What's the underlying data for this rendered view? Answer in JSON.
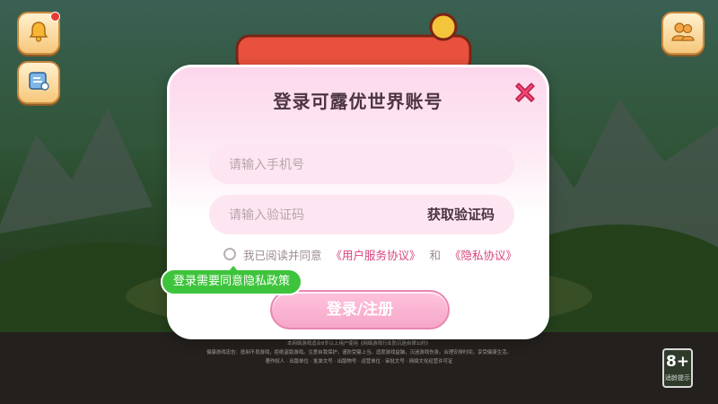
{
  "dialog": {
    "title": "登录可露优世界账号",
    "phone_placeholder": "请输入手机号",
    "code_placeholder": "请输入验证码",
    "get_code_label": "获取验证码",
    "agree_prefix": "我已阅读并同意",
    "user_agreement": "《用户服务协议》",
    "and_text": "和",
    "privacy_policy": "《隐私协议》",
    "submit_label": "登录/注册",
    "close_icon": "close-icon"
  },
  "toast": {
    "message": "登录需要同意隐私政策"
  },
  "corner_buttons": {
    "notification_icon": "bell-icon",
    "notice_icon": "announcement-icon",
    "social_icon": "friends-icon"
  },
  "age_rating": {
    "rating": "8+",
    "caption": "适龄提示"
  },
  "colors": {
    "accent_pink": "#d8437e",
    "toast_green": "#3ec43c",
    "close_red": "#f0476f"
  }
}
